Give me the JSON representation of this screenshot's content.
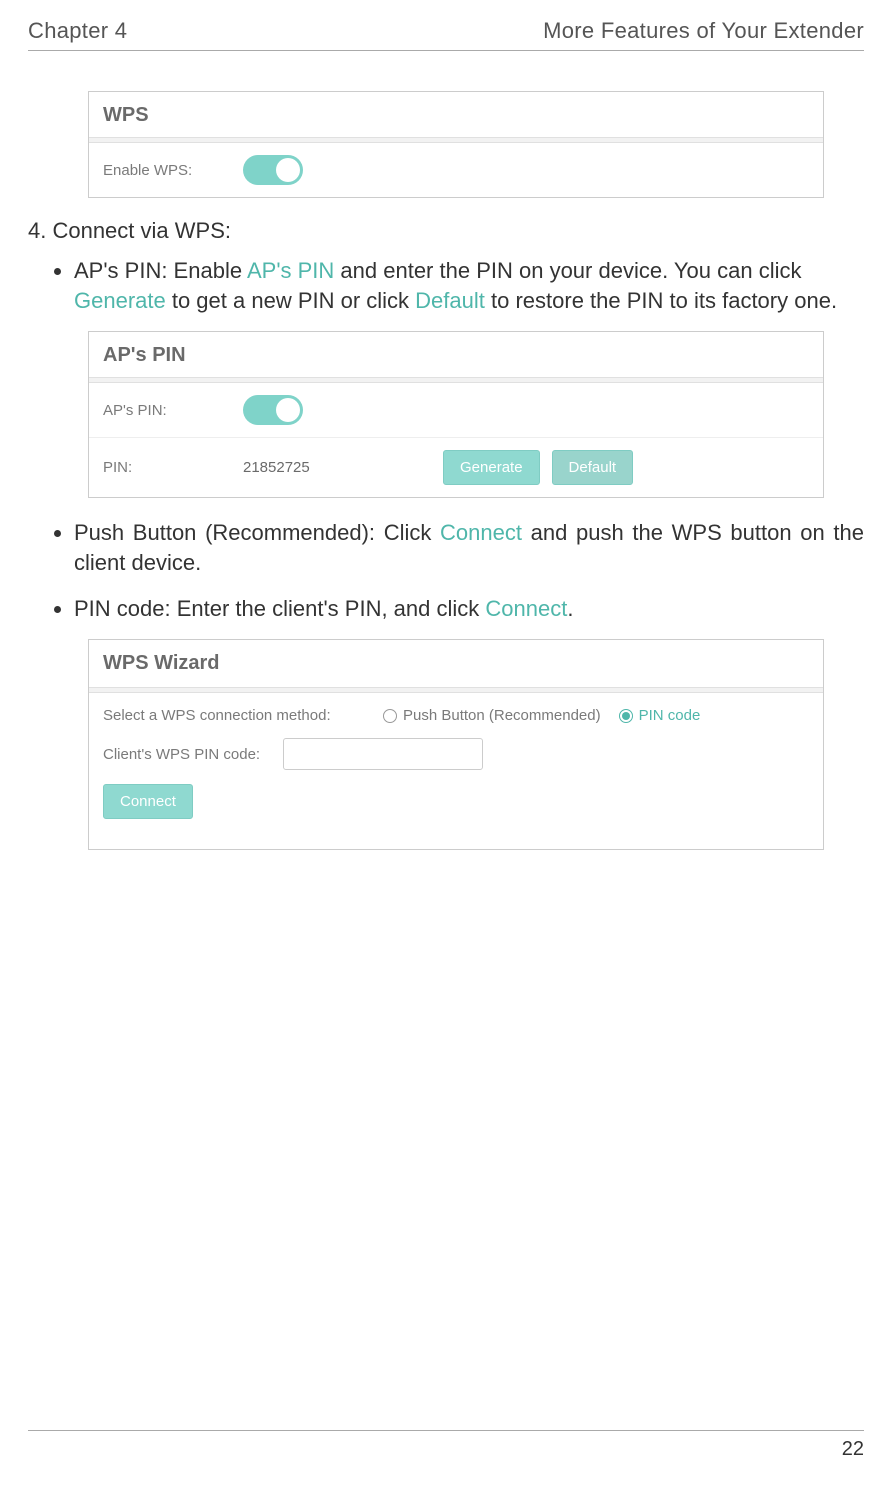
{
  "header": {
    "left": "Chapter 4",
    "right": "More Features of Your Extender"
  },
  "panels": {
    "wps": {
      "title": "WPS",
      "enable_label": "Enable WPS:",
      "enabled": true
    },
    "appin": {
      "title": "AP's PIN",
      "enable_label": "AP's PIN:",
      "enabled": true,
      "pin_label": "PIN:",
      "pin_value": "21852725",
      "generate_label": "Generate",
      "default_label": "Default"
    },
    "wizard": {
      "title": "WPS Wizard",
      "select_label": "Select a WPS connection method:",
      "options": {
        "push_button": "Push Button (Recommended)",
        "pin_code": "PIN code"
      },
      "selected": "pin_code",
      "client_pin_label": "Client's WPS PIN code:",
      "client_pin_value": "",
      "connect_label": "Connect"
    }
  },
  "text": {
    "step4": "4. Connect via WPS:",
    "bullet1_a": "AP's PIN: Enable ",
    "bullet1_hl1": "AP's PIN",
    "bullet1_b": " and enter the PIN on your device. You can click ",
    "bullet1_hl2": "Generate",
    "bullet1_c": " to get a new PIN or click ",
    "bullet1_hl3": "Default",
    "bullet1_d": " to restore the PIN to its factory one.",
    "bullet2_a": "Push Button (Recommended): Click ",
    "bullet2_hl1": "Connect",
    "bullet2_b": " and push the WPS button on the client device.",
    "bullet3_a": "PIN code: Enter the client's PIN, and click ",
    "bullet3_hl1": "Connect",
    "bullet3_b": "."
  },
  "page_number": "22"
}
